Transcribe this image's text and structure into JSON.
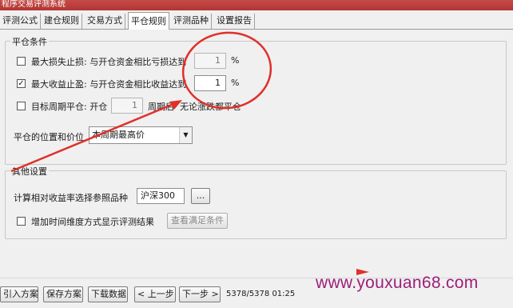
{
  "window": {
    "title": "程序交易评测系统"
  },
  "tabs": [
    {
      "label": "评测公式"
    },
    {
      "label": "建仓规则"
    },
    {
      "label": "交易方式"
    },
    {
      "label": "平仓规则"
    },
    {
      "label": "评测品种"
    },
    {
      "label": "设置报告"
    }
  ],
  "active_tab": "平仓规则",
  "close_conditions": {
    "legend": "平仓条件",
    "stop_loss": {
      "checked": false,
      "label": "最大损失止损: 与开仓资金相比亏损达到",
      "value": "1",
      "unit": "%"
    },
    "take_profit": {
      "checked": true,
      "label": "最大收益止盈: 与开仓资金相比收益达到",
      "value": "1",
      "unit": "%"
    },
    "target_period": {
      "checked": false,
      "label_before": "目标周期平仓: 开仓",
      "value": "1",
      "label_after": "周期后",
      "note": "无论涨跌都平仓"
    },
    "position_price": {
      "label": "平仓的位置和价位",
      "value": "本周期最高价"
    }
  },
  "other_settings": {
    "legend": "其他设置",
    "benchmark": {
      "label": "计算相对收益率选择参照品种",
      "value": "沪深300",
      "browse": "..."
    },
    "time_dimension": {
      "checked": false,
      "label": "增加时间维度方式显示评测结果",
      "button": "查看满足条件"
    }
  },
  "bottom_bar": {
    "buttons": [
      "引入方案",
      "保存方案",
      "下载数据",
      "< 上一步",
      "下一步 >"
    ],
    "status": "5378/5378 01:25"
  },
  "watermark": "www.youxuan68.com",
  "colors": {
    "annotation": "#e0302a",
    "watermark": "#9b1f7a",
    "titlebar": "#b23532"
  }
}
